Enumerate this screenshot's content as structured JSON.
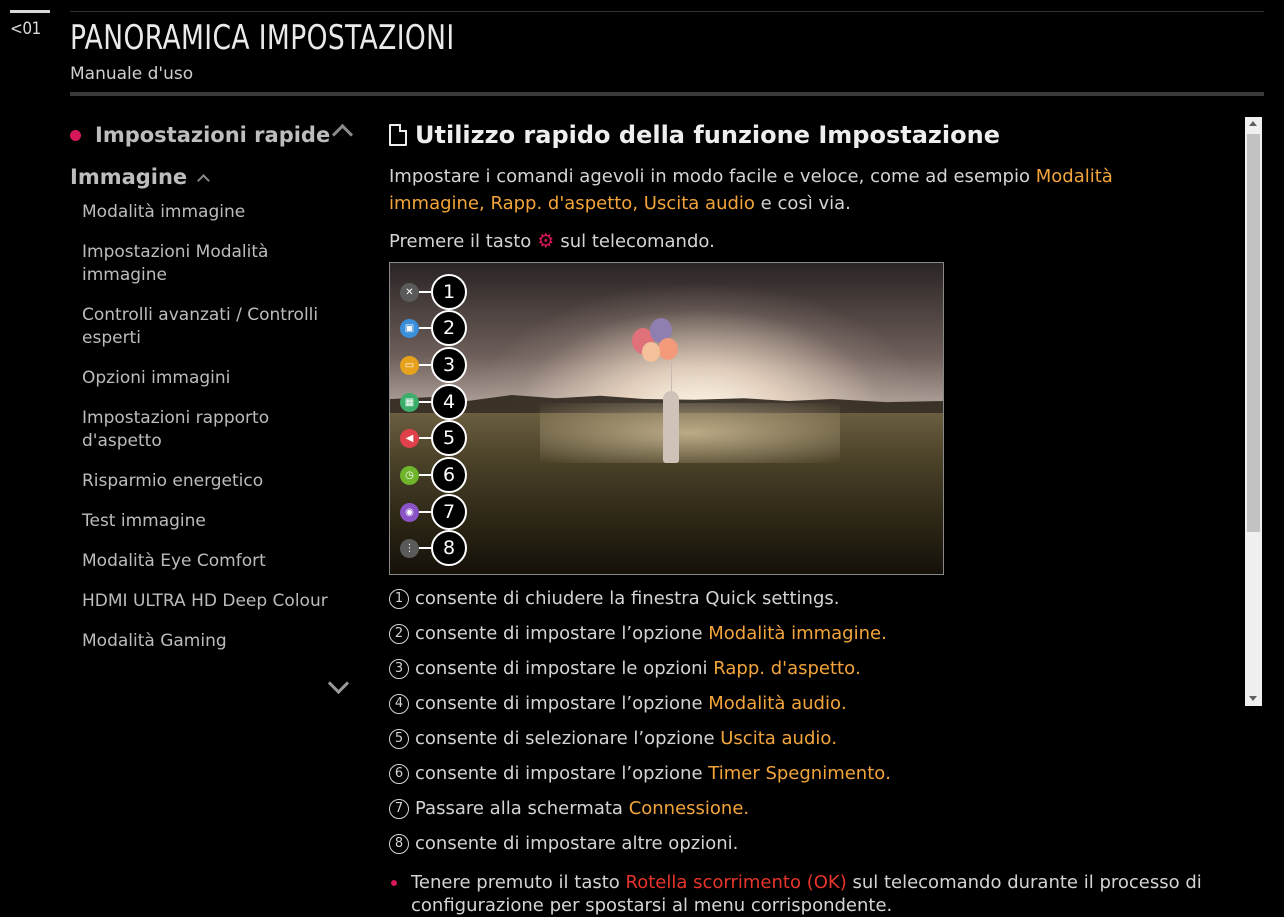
{
  "header": {
    "back_tab": "<01",
    "title": "PANORAMICA IMPOSTAZIONI",
    "subtitle": "Manuale d'uso"
  },
  "sidebar": {
    "section_rapid": "Impostazioni rapide",
    "section_image": "Immagine",
    "items": [
      {
        "label": "Modalità immagine"
      },
      {
        "label": "Impostazioni Modalità immagine"
      },
      {
        "label": "Controlli avanzati / Controlli esperti"
      },
      {
        "label": "Opzioni immagini"
      },
      {
        "label": "Impostazioni rapporto d'aspetto"
      },
      {
        "label": "Risparmio energetico"
      },
      {
        "label": "Test immagine"
      },
      {
        "label": "Modalità Eye Comfort"
      },
      {
        "label": "HDMI ULTRA HD Deep Colour"
      },
      {
        "label": "Modalità Gaming"
      }
    ]
  },
  "content": {
    "heading": "Utilizzo rapido della funzione Impostazione",
    "intro": {
      "pre": "Impostare i comandi agevoli in modo facile e veloce, come ad esempio ",
      "hl1": "Modalità immagine",
      "sep1": ", ",
      "hl2": "Rapp. d'aspetto",
      "sep2": ", ",
      "hl3": "Uscita audio",
      "post": " e così via."
    },
    "press": {
      "pre": "Premere il tasto",
      "post": "sul telecomando."
    },
    "callouts": [
      "1",
      "2",
      "3",
      "4",
      "5",
      "6",
      "7",
      "8"
    ],
    "items": [
      {
        "num": "1",
        "text": "consente di chiudere la finestra Quick settings.",
        "hl": "",
        "end": ""
      },
      {
        "num": "2",
        "text": "consente di impostare l’opzione ",
        "hl": "Modalità immagine",
        "end": "."
      },
      {
        "num": "3",
        "text": "consente di impostare le opzioni ",
        "hl": "Rapp. d'aspetto",
        "end": "."
      },
      {
        "num": "4",
        "text": "consente di impostare l’opzione ",
        "hl": "Modalità audio",
        "end": "."
      },
      {
        "num": "5",
        "text": "consente di selezionare l’opzione ",
        "hl": "Uscita audio",
        "end": "."
      },
      {
        "num": "6",
        "text": "consente di impostare l’opzione ",
        "hl": "Timer Spegnimento",
        "end": "."
      },
      {
        "num": "7",
        "text": "Passare alla schermata ",
        "hl": "Connessione",
        "end": "."
      },
      {
        "num": "8",
        "text": "consente di impostare altre opzioni.",
        "hl": "",
        "end": ""
      }
    ],
    "note": {
      "pre": "Tenere premuto il tasto ",
      "hl": "Rotella scorrimento (OK)",
      "post": " sul telecomando durante il processo di configurazione per spostarsi al menu corrispondente."
    }
  },
  "colors": {
    "accent_orange": "#f3a53b",
    "accent_red": "#e8352b",
    "bullet_magenta": "#d6175a",
    "quick_icons": [
      "#5a5a5a",
      "#3b8fd9",
      "#e6a21c",
      "#3cae6b",
      "#e0424b",
      "#6fb52c",
      "#8a54c7",
      "#5a5a5a"
    ]
  },
  "icons": {
    "quick": [
      "close-icon",
      "picture-mode-icon",
      "aspect-ratio-icon",
      "sound-mode-icon",
      "sound-out-icon",
      "timer-icon",
      "connection-icon",
      "more-icon"
    ]
  }
}
